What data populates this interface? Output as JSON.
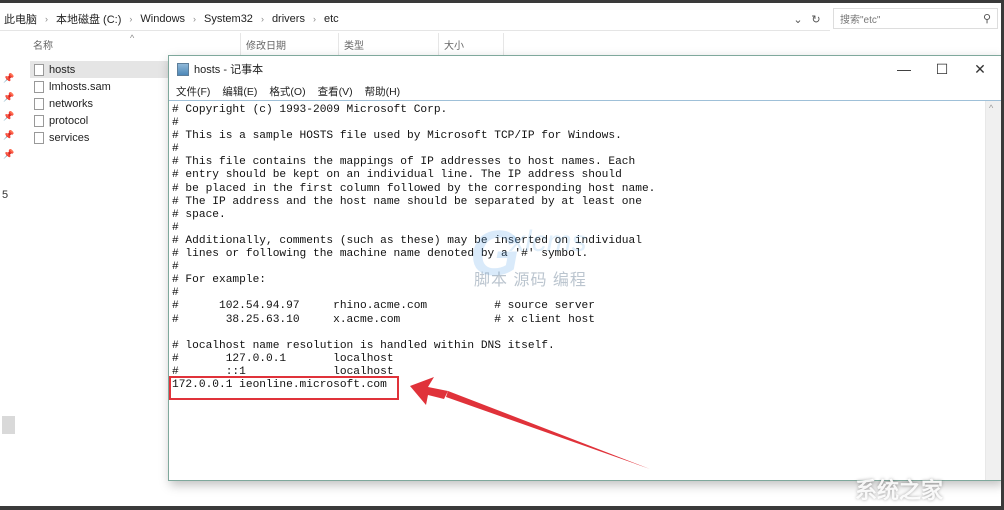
{
  "explorer": {
    "breadcrumb": [
      "此电脑",
      "本地磁盘 (C:)",
      "Windows",
      "System32",
      "drivers",
      "etc"
    ],
    "search_placeholder": "搜索\"etc\"",
    "columns": {
      "name": "名称",
      "modified": "修改日期",
      "type": "类型",
      "size": "大小"
    },
    "sort_indicator": "^",
    "files": [
      {
        "name": "hosts",
        "selected": true
      },
      {
        "name": "lmhosts.sam",
        "selected": false
      },
      {
        "name": "networks",
        "selected": false
      },
      {
        "name": "protocol",
        "selected": false
      },
      {
        "name": "services",
        "selected": false
      }
    ],
    "nav_number": "5"
  },
  "notepad": {
    "title": "hosts - 记事本",
    "menu": [
      "文件(F)",
      "编辑(E)",
      "格式(O)",
      "查看(V)",
      "帮助(H)"
    ],
    "window_controls": {
      "minimize": "—",
      "maximize": "☐",
      "close": "✕"
    },
    "content": "# Copyright (c) 1993-2009 Microsoft Corp.\n#\n# This is a sample HOSTS file used by Microsoft TCP/IP for Windows.\n#\n# This file contains the mappings of IP addresses to host names. Each\n# entry should be kept on an individual line. The IP address should\n# be placed in the first column followed by the corresponding host name.\n# The IP address and the host name should be separated by at least one\n# space.\n#\n# Additionally, comments (such as these) may be inserted on individual\n# lines or following the machine name denoted by a '#' symbol.\n#\n# For example:\n#\n#      102.54.94.97     rhino.acme.com          # source server\n#       38.25.63.10     x.acme.com              # x client host\n\n# localhost name resolution is handled within DNS itself.\n#\t127.0.0.1       localhost\n#\t::1             localhost\n172.0.0.1 ieonline.microsoft.com",
    "highlighted_line": "172.0.0.1 ieonline.microsoft.com"
  },
  "annotation": {
    "color": "#e0323a"
  },
  "watermarks": {
    "center_logo": "G",
    "center_logo_tail": "xlcms",
    "center_cn": "脚本 源码 编程",
    "corner": "系统之家"
  }
}
